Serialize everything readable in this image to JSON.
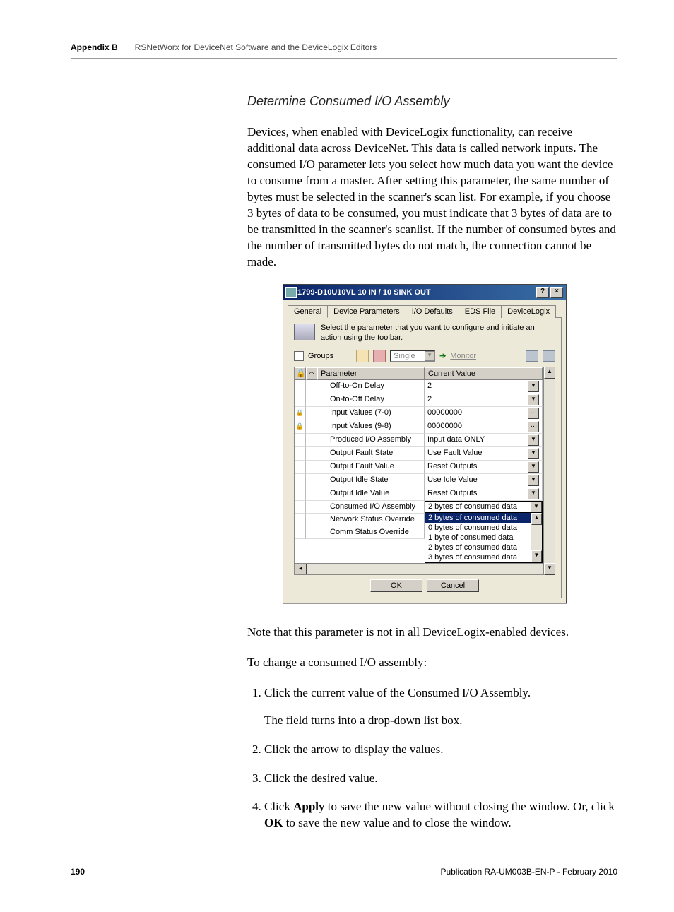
{
  "header": {
    "appendix": "Appendix B",
    "title": "RSNetWorx for DeviceNet Software and the DeviceLogix Editors"
  },
  "section_heading": "Determine Consumed I/O Assembly",
  "intro_para": "Devices, when enabled with DeviceLogix functionality, can receive additional data across DeviceNet. This data is called network inputs. The consumed I/O parameter lets you select how much data you want the device to consume from a master. After setting this parameter, the same number of bytes must be selected in the scanner's scan list. For example, if you choose 3 bytes of data to be consumed, you must indicate that 3 bytes of data are to be transmitted in the scanner's scanlist. If the number of consumed bytes and the number of transmitted bytes do not match, the connection cannot be made.",
  "dialog": {
    "title": "1799-D10U10VL 10 IN / 10 SINK OUT",
    "help_btn": "?",
    "close_btn": "×",
    "tabs": {
      "general": "General",
      "device_params": "Device Parameters",
      "io_defaults": "I/O Defaults",
      "eds_file": "EDS File",
      "devicelogix": "DeviceLogix"
    },
    "instruction": "Select the parameter that you want to configure and initiate an action using the toolbar.",
    "toolbar": {
      "groups": "Groups",
      "single": "Single",
      "monitor": "Monitor"
    },
    "columns": {
      "parameter": "Parameter",
      "current_value": "Current Value"
    },
    "rows": [
      {
        "locked": false,
        "param": "Off-to-On Delay",
        "value": "2",
        "ctrl": "dd"
      },
      {
        "locked": false,
        "param": "On-to-Off Delay",
        "value": "2",
        "ctrl": "dd"
      },
      {
        "locked": true,
        "param": "Input Values (7-0)",
        "value": "00000000",
        "ctrl": "dots"
      },
      {
        "locked": true,
        "param": "Input Values (9-8)",
        "value": "00000000",
        "ctrl": "dots"
      },
      {
        "locked": false,
        "param": "Produced I/O Assembly",
        "value": "Input data ONLY",
        "ctrl": "dd"
      },
      {
        "locked": false,
        "param": "Output Fault State",
        "value": "Use Fault Value",
        "ctrl": "dd"
      },
      {
        "locked": false,
        "param": "Output Fault Value",
        "value": "Reset Outputs",
        "ctrl": "dd"
      },
      {
        "locked": false,
        "param": "Output Idle State",
        "value": "Use Idle Value",
        "ctrl": "dd"
      },
      {
        "locked": false,
        "param": "Output Idle Value",
        "value": "Reset Outputs",
        "ctrl": "dd"
      }
    ],
    "open_row": {
      "param": "Consumed I/O Assembly",
      "value": "2 bytes of consumed data"
    },
    "below_rows": [
      {
        "param": "Network Status Override"
      },
      {
        "param": "Comm Status Override"
      }
    ],
    "dropdown": {
      "selected": "2 bytes of consumed data",
      "options": [
        "0 bytes of consumed data",
        "1 byte of consumed data",
        "2 bytes of consumed data",
        "3 bytes of consumed data"
      ]
    },
    "buttons": {
      "ok": "OK",
      "cancel": "Cancel"
    }
  },
  "after_note": "Note that this parameter is not in all DeviceLogix-enabled devices.",
  "change_intro": "To change a consumed I/O assembly:",
  "steps": {
    "s1": "Click the current value of the Consumed I/O Assembly.",
    "s1b": "The field turns into a drop-down list box.",
    "s2": "Click the arrow to display the values.",
    "s3": "Click the desired value.",
    "s4a": "Click ",
    "s4b": "Apply",
    "s4c": " to save the new value without closing the window. Or, click ",
    "s4d": "OK",
    "s4e": " to save the new value and to close the window."
  },
  "footer": {
    "page": "190",
    "pub": "Publication RA-UM003B-EN-P - February 2010"
  }
}
